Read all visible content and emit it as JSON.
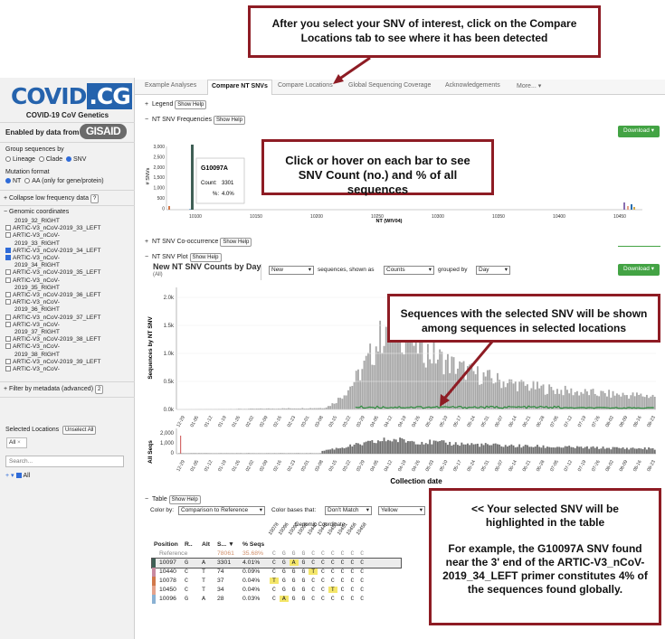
{
  "callouts": {
    "top": "After you select your SNV of interest, click on the Compare Locations tab to see where it has been detected",
    "bar": "Click or hover on each bar to see SNV Count (no.) and % of all sequences",
    "plot": "Sequences with the selected SNV will be shown among sequences in selected locations",
    "table_title": "<< Your selected SNV will be highlighted in the table",
    "table_body": "For example, the G10097A SNV found near the 3' end of the ARTIC-V3_nCoV-2019_34_LEFT primer constitutes 4% of the sequences found globally."
  },
  "sidebar": {
    "logo_text": "COVID",
    "logo_highlight": ".CG",
    "tagline": "COVID-19 CoV Genetics",
    "enabled_by": "Enabled by data from",
    "gisaid": "GISAID",
    "group_label": "Group sequences by",
    "group_options": [
      "Lineage",
      "Clade",
      "SNV"
    ],
    "group_selected": "SNV",
    "mutation_label": "Mutation format",
    "mutation_options": [
      "NT",
      "AA (only for gene/protein)"
    ],
    "collapse_label": "Collapse low frequency data",
    "collapse_help": "?",
    "genomic_label": "Genomic coordinates",
    "primers": [
      {
        "label": "2019_32_RIGHT",
        "checked": false,
        "indent": true
      },
      {
        "label": "ARTIC-V3_nCoV-2019_33_LEFT",
        "checked": false
      },
      {
        "label": "ARTIC-V3_nCoV-",
        "checked": false
      },
      {
        "label": "2019_33_RIGHT",
        "checked": false,
        "indent": true
      },
      {
        "label": "ARTIC-V3_nCoV-2019_34_LEFT",
        "checked": true
      },
      {
        "label": "ARTIC-V3_nCoV-",
        "checked": true
      },
      {
        "label": "2019_34_RIGHT",
        "checked": false,
        "indent": true
      },
      {
        "label": "ARTIC-V3_nCoV-2019_35_LEFT",
        "checked": false
      },
      {
        "label": "ARTIC-V3_nCoV-",
        "checked": false
      },
      {
        "label": "2019_35_RIGHT",
        "checked": false,
        "indent": true
      },
      {
        "label": "ARTIC-V3_nCoV-2019_36_LEFT",
        "checked": false
      },
      {
        "label": "ARTIC-V3_nCoV-",
        "checked": false
      },
      {
        "label": "2019_36_RIGHT",
        "checked": false,
        "indent": true
      },
      {
        "label": "ARTIC-V3_nCoV-2019_37_LEFT",
        "checked": false
      },
      {
        "label": "ARTIC-V3_nCoV-",
        "checked": false
      },
      {
        "label": "2019_37_RIGHT",
        "checked": false,
        "indent": true
      },
      {
        "label": "ARTIC-V3_nCoV-2019_38_LEFT",
        "checked": false
      },
      {
        "label": "ARTIC-V3_nCoV-",
        "checked": false
      },
      {
        "label": "2019_38_RIGHT",
        "checked": false,
        "indent": true
      },
      {
        "label": "ARTIC-V3_nCoV-2019_39_LEFT",
        "checked": false
      },
      {
        "label": "ARTIC-V3_nCoV-",
        "checked": false
      },
      {
        "label": "2019_39_RIGHT",
        "checked": false,
        "indent": true
      }
    ],
    "filter_label": "Filter by metadata (advanced)",
    "filter_help": "2",
    "selected_locations": "Selected Locations",
    "unselect_all": "Unselect All",
    "all_tag": "All",
    "search_placeholder": "Search...",
    "tree_all": "All"
  },
  "tabs": [
    "Example Analyses",
    "Compare NT SNVs",
    "Compare Locations",
    "Global Sequencing Coverage",
    "Acknowledgements",
    "More..."
  ],
  "active_tab": "Compare NT SNVs",
  "legend": {
    "label": "Legend",
    "help": "Show Help"
  },
  "freq": {
    "label": "NT SNV Frequencies",
    "help": "Show Help",
    "download": "Download",
    "ylabel": "# SNVs",
    "yticks": [
      "3,000",
      "2,500",
      "2,000",
      "1,500",
      "1,000",
      "500",
      "0"
    ],
    "xticks": [
      "10100",
      "10150",
      "10200",
      "10250",
      "10300",
      "10350",
      "10400",
      "10450"
    ],
    "xlabel": "NT (WIV04)",
    "tooltip": {
      "title": "G10097A",
      "count_label": "Count:",
      "count": "3301",
      "pct_label": "%:",
      "pct": "4.0%"
    }
  },
  "cooccur": {
    "label": "NT SNV Co-occurrence",
    "help": "Show Help"
  },
  "plot": {
    "label": "NT SNV Plot",
    "help": "Show Help",
    "title": "New NT SNV Counts by Day",
    "subtitle": "(All)",
    "select1": "New",
    "text1": "sequences, shown as",
    "select2": "Counts",
    "text2": "grouped by",
    "select3": "Day",
    "download": "Download",
    "ylabel": "Sequences by NT SNV",
    "xlabel": "Collection date",
    "allseqs_label": "All Seqs",
    "yticks": [
      "2.0k",
      "1.5k",
      "1.0k",
      "0.5k",
      "0.0k"
    ],
    "allseqs_yticks": [
      "2,000",
      "1,000",
      "0"
    ],
    "dates": [
      "12-29",
      "01-05",
      "01-12",
      "01-19",
      "01-26",
      "02-02",
      "02-09",
      "02-16",
      "02-23",
      "03-01",
      "03-08",
      "03-15",
      "03-22",
      "03-29",
      "04-05",
      "04-12",
      "04-19",
      "04-26",
      "05-03",
      "05-10",
      "05-17",
      "05-24",
      "05-31",
      "06-07",
      "06-14",
      "06-21",
      "06-28",
      "07-05",
      "07-12",
      "07-19",
      "07-26",
      "08-02",
      "08-09",
      "08-16",
      "08-23"
    ]
  },
  "table": {
    "label": "Table",
    "help": "Show Help",
    "colorby_label": "Color by:",
    "colorby_value": "Comparison to Reference",
    "colorbases_label": "Color bases that:",
    "colorbases_value": "Don't Match",
    "color_value": "Yellow",
    "genomic_header": "Genomic Coordinate",
    "columns": [
      "Position",
      "R..",
      "Alt",
      "S... ▼",
      "% Seqs"
    ],
    "coord_cols": [
      "10078",
      "10096",
      "10097",
      "10098",
      "10440",
      "10449",
      "10450",
      "10451",
      "10456",
      "10458"
    ],
    "rows": [
      {
        "pos": "Reference",
        "ref": "",
        "alt": "",
        "count": "78061",
        "pct": "35.68%",
        "bases": [
          "C",
          "G",
          "G",
          "G",
          "C",
          "C",
          "C",
          "C",
          "C",
          "C"
        ],
        "hl": [],
        "color": "#ffffff",
        "sel": false
      },
      {
        "pos": "10097",
        "ref": "G",
        "alt": "A",
        "count": "3301",
        "pct": "4.01%",
        "bases": [
          "C",
          "G",
          "A",
          "G",
          "C",
          "C",
          "C",
          "C",
          "C",
          "C"
        ],
        "hl": [
          2
        ],
        "color": "#3f5f55",
        "sel": true
      },
      {
        "pos": "10440",
        "ref": "C",
        "alt": "T",
        "count": "74",
        "pct": "0.09%",
        "bases": [
          "C",
          "G",
          "G",
          "G",
          "T",
          "C",
          "C",
          "C",
          "C",
          "C"
        ],
        "hl": [
          4
        ],
        "color": "#c98aa0",
        "sel": false
      },
      {
        "pos": "10078",
        "ref": "C",
        "alt": "T",
        "count": "37",
        "pct": "0.04%",
        "bases": [
          "T",
          "G",
          "G",
          "G",
          "C",
          "C",
          "C",
          "C",
          "C",
          "C"
        ],
        "hl": [
          0
        ],
        "color": "#d1784a",
        "sel": false
      },
      {
        "pos": "10450",
        "ref": "C",
        "alt": "T",
        "count": "34",
        "pct": "0.04%",
        "bases": [
          "C",
          "G",
          "G",
          "G",
          "C",
          "C",
          "T",
          "C",
          "C",
          "C"
        ],
        "hl": [
          6
        ],
        "color": "#e5a28b",
        "sel": false
      },
      {
        "pos": "10096",
        "ref": "G",
        "alt": "A",
        "count": "28",
        "pct": "0.03%",
        "bases": [
          "C",
          "A",
          "G",
          "G",
          "C",
          "C",
          "C",
          "C",
          "C",
          "C"
        ],
        "hl": [
          1
        ],
        "color": "#8ab1d3",
        "sel": false
      }
    ]
  }
}
